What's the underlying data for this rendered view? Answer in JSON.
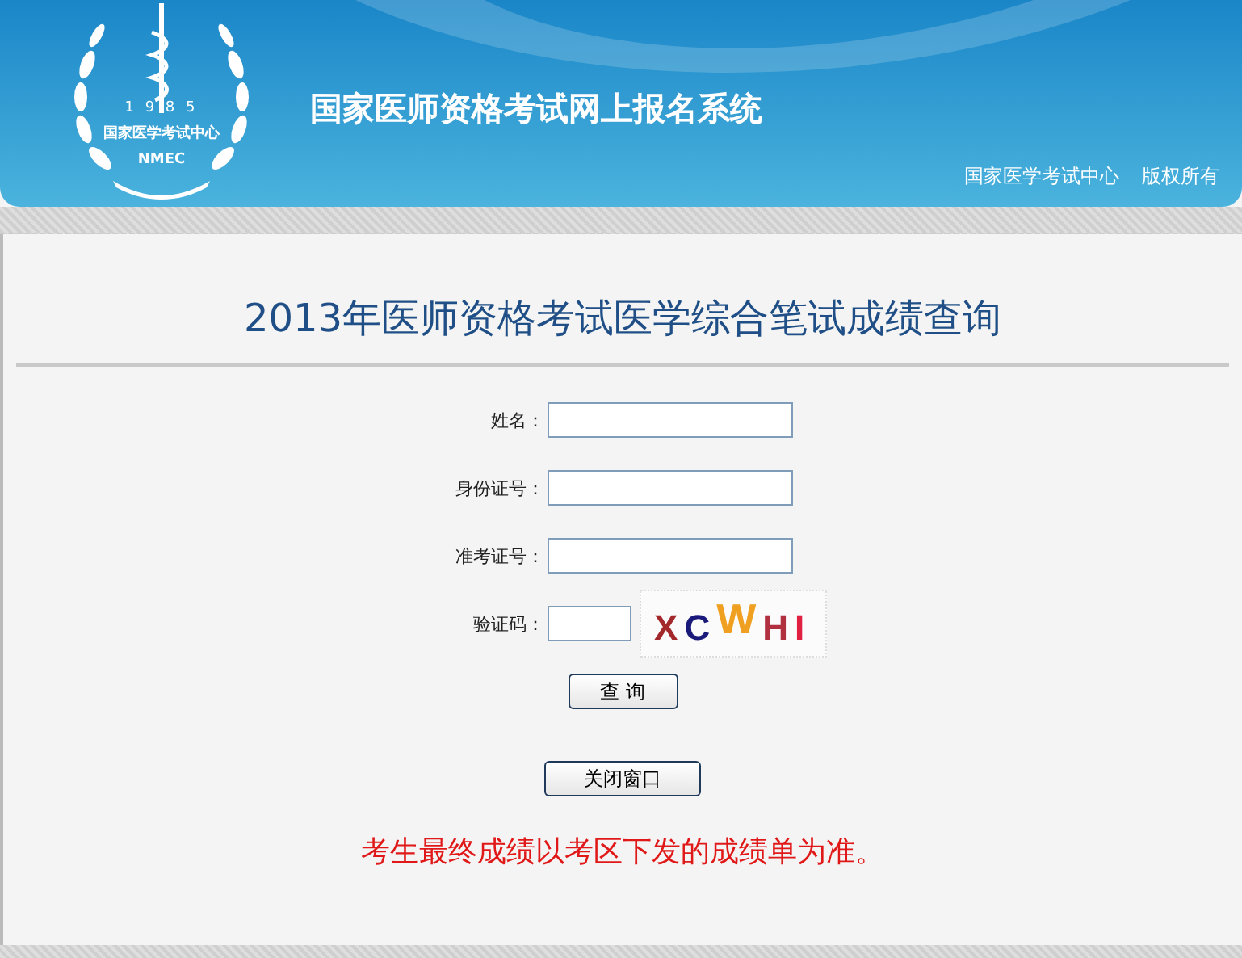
{
  "header": {
    "logo": {
      "year": "1 9 8 5",
      "org": "国家医学考试中心",
      "abbr": "NMEC"
    },
    "title": "国家医师资格考试网上报名系统",
    "credits": [
      "国家医学考试中心",
      "版权所有"
    ]
  },
  "page_title": "2013年医师资格考试医学综合笔试成绩查询",
  "form": {
    "fields": [
      {
        "label": "姓名：",
        "kind": "text"
      },
      {
        "label": "身份证号：",
        "kind": "text"
      },
      {
        "label": "准考证号：",
        "kind": "text"
      },
      {
        "label": "验证码：",
        "kind": "captcha"
      }
    ],
    "captcha": [
      {
        "char": "X",
        "color": "#a3282c"
      },
      {
        "char": "C",
        "color": "#1a1a7a"
      },
      {
        "char": "W",
        "color": "#f0a020"
      },
      {
        "char": "H",
        "color": "#b03040"
      },
      {
        "char": "I",
        "color": "#e02040"
      }
    ],
    "submit": "查 询"
  },
  "close_button": "关闭窗口",
  "notice": "考生最终成绩以考区下发的成绩单为准。"
}
